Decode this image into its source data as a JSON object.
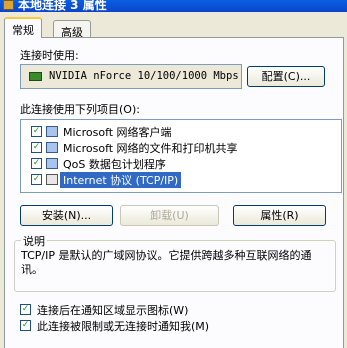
{
  "window": {
    "title": "本地连接 3 属性"
  },
  "tabs": [
    {
      "label": "常规"
    },
    {
      "label": "高级"
    }
  ],
  "connect_using": {
    "label": "连接时使用:",
    "adapter_name": "NVIDIA nForce 10/100/1000 Mbps",
    "configure_label": "配置(C)..."
  },
  "components": {
    "label": "此连接使用下列项目(O):",
    "items": [
      {
        "label": "Microsoft 网络客户端",
        "checked": true,
        "icon": "network-client-icon"
      },
      {
        "label": "Microsoft 网络的文件和打印机共享",
        "checked": true,
        "icon": "file-share-icon"
      },
      {
        "label": "QoS 数据包计划程序",
        "checked": true,
        "icon": "qos-icon"
      },
      {
        "label": "Internet 协议 (TCP/IP)",
        "checked": true,
        "icon": "protocol-icon",
        "selected": true
      }
    ]
  },
  "buttons": {
    "install": "安装(N)...",
    "uninstall": "卸载(U)",
    "properties": "属性(R)"
  },
  "description": {
    "caption": "说明",
    "text": "TCP/IP 是默认的广域网协议。它提供跨越多种互联网络的通讯。"
  },
  "options": [
    {
      "label": "连接后在通知区域显示图标(W)",
      "checked": true
    },
    {
      "label": "此连接被限制或无连接时通知我(M)",
      "checked": true
    }
  ],
  "colors": {
    "selection": "#316ac5",
    "title_bar": "#0a5fe0",
    "dialog_bg": "#ece9d8"
  }
}
